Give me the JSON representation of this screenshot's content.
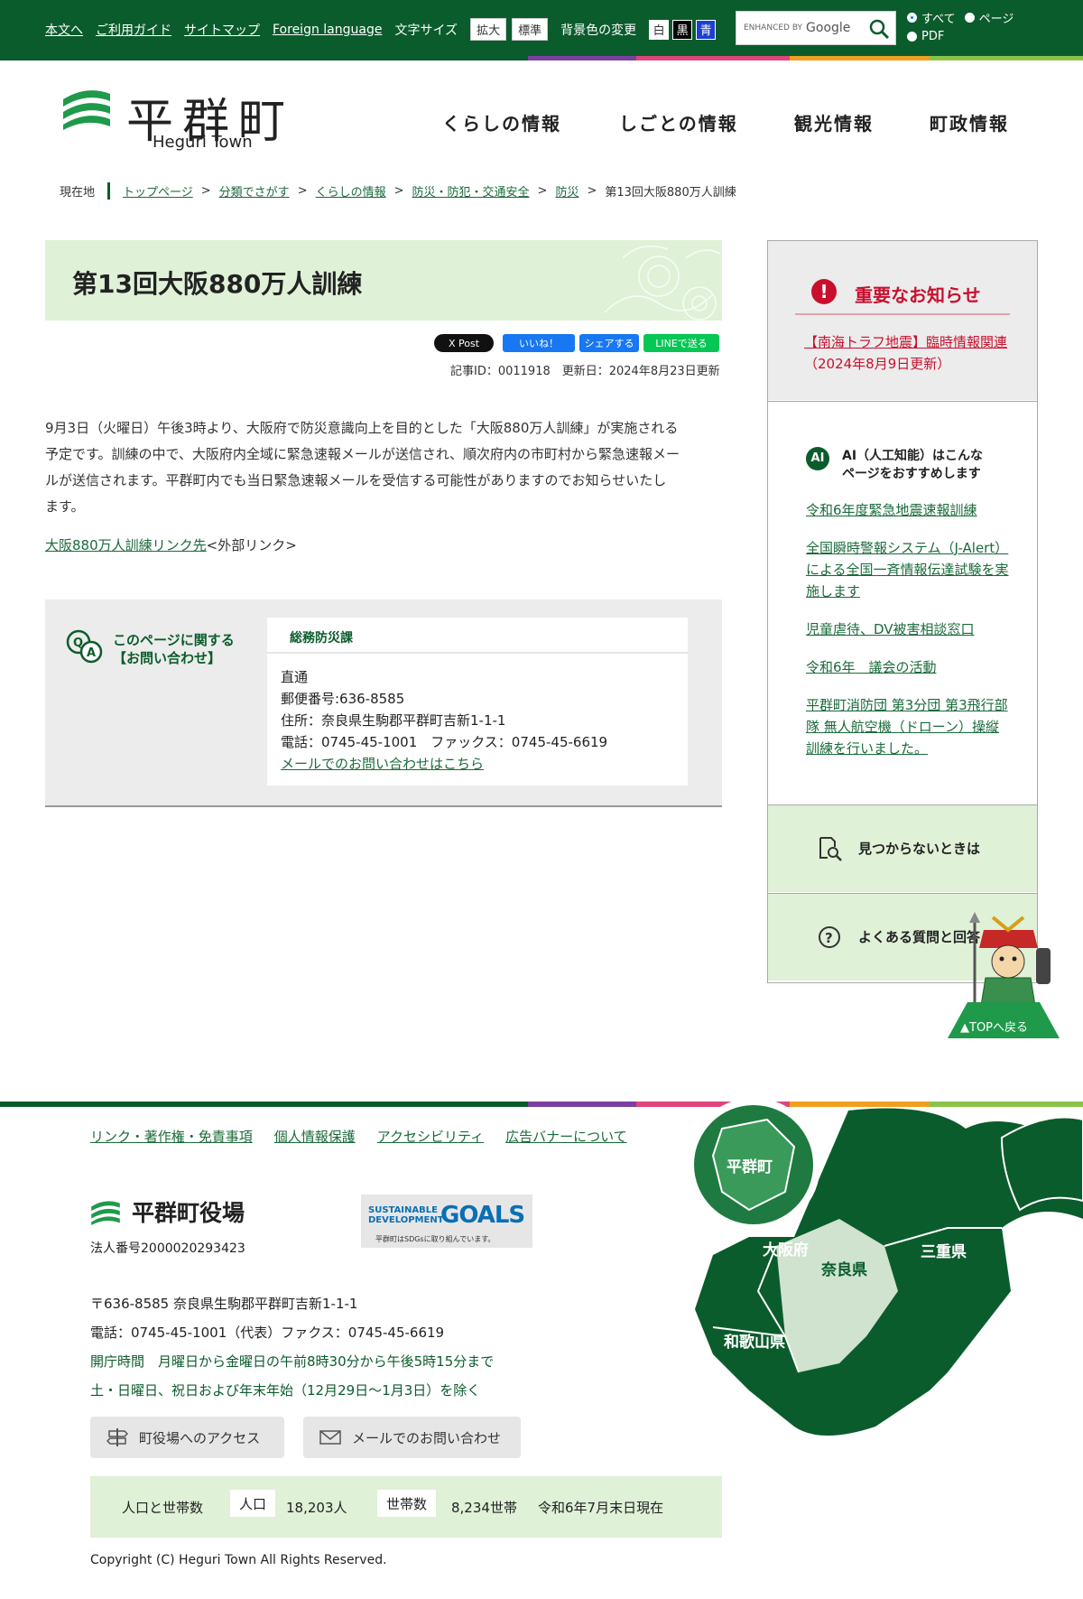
{
  "topbar": {
    "links": [
      "本文へ",
      "ご利用ガイド",
      "サイトマップ",
      "Foreign language"
    ],
    "font_size_label": "文字サイズ",
    "font_size_buttons": [
      "拡大",
      "標準"
    ],
    "bg_label": "背景色の変更",
    "bg_buttons": [
      "白",
      "黒",
      "青"
    ],
    "search": {
      "enhanced": "ENHANCED BY",
      "google": "Google"
    },
    "scope": {
      "all": "すべて",
      "page": "ページ",
      "pdf": "PDF"
    }
  },
  "header": {
    "logo_kanji": "平群町",
    "logo_en": "Heguri Town",
    "nav": [
      "くらしの情報",
      "しごとの情報",
      "観光情報",
      "町政情報"
    ]
  },
  "breadcrumb": {
    "current_label": "現在地",
    "items": [
      "トップページ",
      "分類でさがす",
      "くらしの情報",
      "防災・防犯・交通安全",
      "防災"
    ],
    "current": "第13回大阪880万人訓練",
    "sep": ">"
  },
  "article": {
    "title": "第13回大阪880万人訓練",
    "share": {
      "post": "X Post",
      "like": "いいね！",
      "share": "シェアする",
      "line": "LINEで送る"
    },
    "meta": "記事ID：0011918　更新日：2024年8月23日更新",
    "body": [
      "9月3日（火曜日）午後3時より、大阪府で防災意識向上を目的とした「大阪880万人訓練」が実施される",
      "予定です。訓練の中で、大阪府内全域に緊急速報メールが送信され、順次府内の市町村から緊急速報メー",
      "ルが送信されます。平群町内でも当日緊急速報メールを受信する可能性がありますのでお知らせいたし",
      "ます。"
    ],
    "ext_link": "大阪880万人訓練リンク先",
    "ext_note": "<外部リンク>"
  },
  "contact": {
    "label1": "このページに関する",
    "label2": "【お問い合わせ】",
    "dept": "総務防災課",
    "lines": [
      "直通",
      "郵便番号:636-8585",
      "住所：奈良県生駒郡平群町吉新1-1-1",
      "電話：0745-45-1001　ファックス：0745-45-6619"
    ],
    "mail": "メールでのお問い合わせはこちら"
  },
  "sidebar": {
    "alert_title": "重要なお知らせ",
    "alert_link": "【南海トラフ地震】臨時情報関連",
    "alert_date": "（2024年8月9日更新）",
    "ai_icon": "AI",
    "ai_title1": "AI（人工知能）はこんな",
    "ai_title2": "ページをおすすめします",
    "ai_links": [
      "令和6年度緊急地震速報訓練",
      "全国瞬時警報システム（J-Alert）による全国一斉情報伝達試験を実施します",
      "児童虐待、DV被害相談窓口",
      "令和6年　議会の活動",
      "平群町消防団 第3分団 第3飛行部隊 無人航空機（ドローン）操縦訓練を行いました。"
    ],
    "notfound": "見つからないときは",
    "faq": "よくある質問と回答",
    "totop": "▲TOPへ戻る"
  },
  "footer": {
    "links": [
      "リンク・著作権・免責事項",
      "個人情報保護",
      "アクセシビリティ",
      "広告バナーについて"
    ],
    "office": "平群町役場",
    "corp_no": "法人番号2000020293423",
    "sdgs_a1": "SUSTAINABLE",
    "sdgs_a2": "DEVELOPMENT",
    "sdgs_b": "GOALS",
    "sdgs_c": "平群町はSDGsに取り組んでいます。",
    "address": "〒636-8585 奈良県生駒郡平群町吉新1-1-1",
    "tel": "電話：0745-45-1001（代表）ファクス：0745-45-6619",
    "hours1": "開庁時間　月曜日から金曜日の午前8時30分から午後5時15分まで",
    "hours2": "土・日曜日、祝日および年末年始（12月29日～1月3日）を除く",
    "access_btn": "町役場へのアクセス",
    "mail_btn": "メールでのお問い合わせ",
    "pop_label": "人口と世帯数",
    "pop_key": "人口",
    "pop_val": "18,203人",
    "hh_key": "世帯数",
    "hh_val": "8,234世帯",
    "pop_date": "令和6年7月末日現在",
    "copyright": "Copyright (C) Heguri Town All Rights Reserved.",
    "map_labels": {
      "heguri": "平群町",
      "osaka": "大阪府",
      "nara": "奈良県",
      "mie": "三重県",
      "wakayama": "和歌山県"
    }
  },
  "colors": {
    "brand_green": "#0b5c2c",
    "light_green": "#dff1d7",
    "alert_red": "#c8102e"
  }
}
